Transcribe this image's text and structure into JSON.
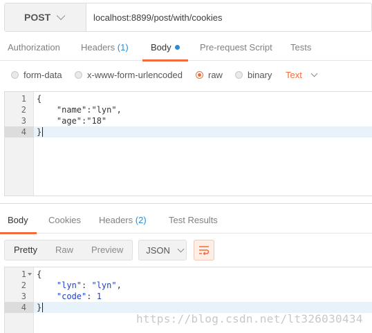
{
  "request": {
    "method": "POST",
    "url": "localhost:8899/post/with/cookies"
  },
  "request_tabs": {
    "authorization": "Authorization",
    "headers": "Headers",
    "headers_count": "(1)",
    "body": "Body",
    "prerequest": "Pre-request Script",
    "tests": "Tests"
  },
  "body_options": {
    "form_data": "form-data",
    "urlencoded": "x-www-form-urlencoded",
    "raw": "raw",
    "binary": "binary",
    "type": "Text",
    "selected": "raw"
  },
  "request_body": {
    "lines": [
      {
        "n": "1",
        "text": "{"
      },
      {
        "n": "2",
        "text": "    \"name\":\"lyn\","
      },
      {
        "n": "3",
        "text": "    \"age\":\"18\""
      },
      {
        "n": "4",
        "text": "}"
      }
    ]
  },
  "response_tabs": {
    "body": "Body",
    "cookies": "Cookies",
    "headers": "Headers",
    "headers_count": "(2)",
    "test_results": "Test Results"
  },
  "response_toolbar": {
    "pretty": "Pretty",
    "raw": "Raw",
    "preview": "Preview",
    "format": "JSON",
    "wrap_icon": "wrap-lines-icon"
  },
  "response_body": {
    "lines": [
      {
        "n": "1",
        "text": "{"
      },
      {
        "n": "2",
        "key": "    \"lyn\"",
        "sep": ": ",
        "val": "\"lyn\"",
        "end": ","
      },
      {
        "n": "3",
        "key": "    \"code\"",
        "sep": ": ",
        "val": "1",
        "end": ""
      },
      {
        "n": "4",
        "text": "}"
      }
    ]
  },
  "watermark": "https://blog.csdn.net/lt326030434",
  "colors": {
    "accent": "#f26b3a",
    "link": "#2a8bd6",
    "json_value": "#1d3fc4"
  }
}
